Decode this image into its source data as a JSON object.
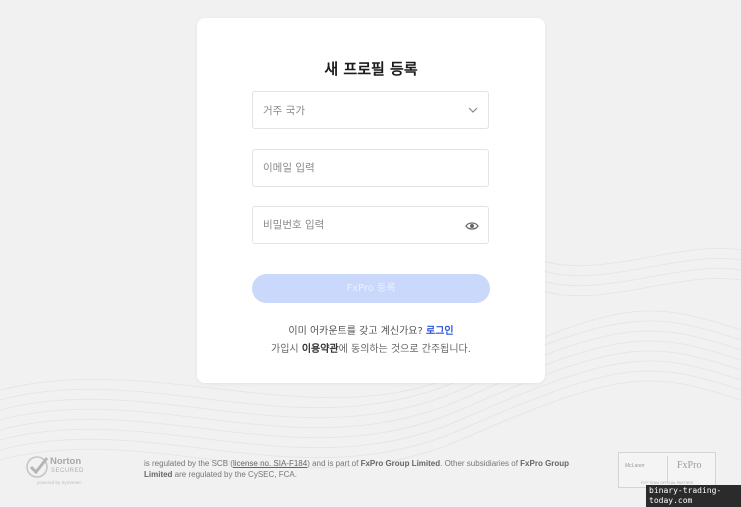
{
  "form": {
    "title": "새 프로필 등록",
    "country_placeholder": "거주 국가",
    "email_placeholder": "이메일 입력",
    "password_placeholder": "비밀번호 입력",
    "submit_label": "FxPro 등록",
    "already_have_account": "이미 어카운트를 갖고 계신가요?",
    "login_link": "로그인",
    "terms_prefix": "가입시 ",
    "terms_link": "이용약관",
    "terms_suffix": "에 동의하는 것으로 간주됩니다."
  },
  "footer": {
    "norton_name": "Norton",
    "norton_sub": "SECURED",
    "norton_powered": "powered by Symantec",
    "legal_1": " is regulated by the SCB (",
    "legal_license": "license no. SIA-F184",
    "legal_2": ") and is part of ",
    "legal_group": "FxPro Group Limited",
    "legal_3": ". Other subsidiaries of ",
    "legal_group2": "FxPro Group Limited",
    "legal_4": " are regulated by the CySEC, FCA.",
    "partner_mclaren": "McLaren",
    "partner_fxpro": "FxPro",
    "partner_note": "F1™ TEAM OFFICIAL PARTNER",
    "watermark": "binary-trading-today.com"
  },
  "colors": {
    "accent": "#2d55d9",
    "submit_disabled": "#c9d8fb",
    "background": "#f1f1f1"
  }
}
